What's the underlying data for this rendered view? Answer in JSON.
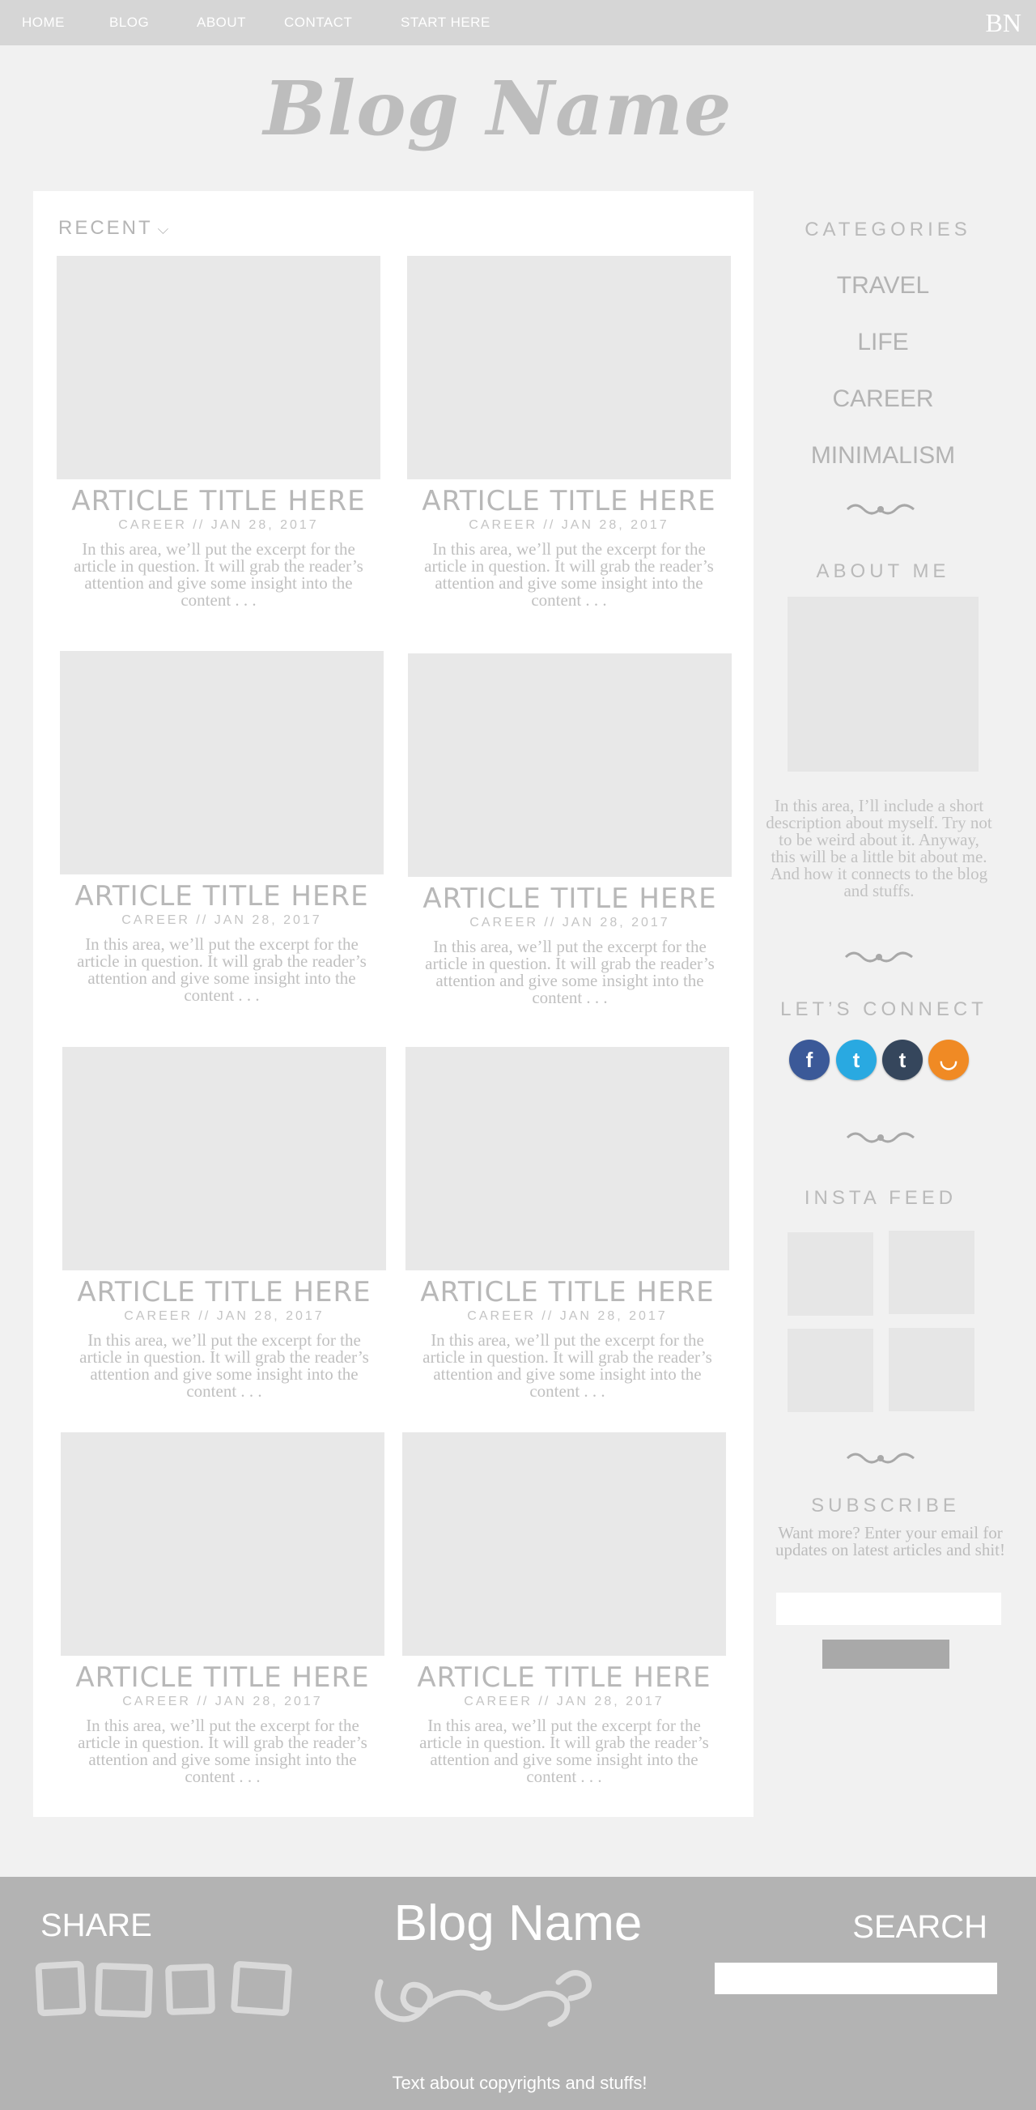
{
  "nav": {
    "items": [
      "HOME",
      "BLOG",
      "ABOUT",
      "CONTACT",
      "START HERE"
    ],
    "monogram": "BN"
  },
  "header": {
    "blog_name": "Blog Name"
  },
  "recent": {
    "label": "RECENT",
    "icon": "chevron-down-icon"
  },
  "posts": [
    {
      "title": "ARTICLE TITLE HERE",
      "meta": "CAREER // JAN 28, 2017",
      "excerpt": "In this area, we’ll put the excerpt for the article in question. It will grab the reader’s attention and give some insight into the content . . ."
    },
    {
      "title": "ARTICLE TITLE HERE",
      "meta": "CAREER // JAN 28, 2017",
      "excerpt": "In this area, we’ll put the excerpt for the article in question. It will grab the reader’s attention and give some insight into the content . . ."
    },
    {
      "title": "ARTICLE TITLE HERE",
      "meta": "CAREER // JAN 28, 2017",
      "excerpt": "In this area, we’ll put the excerpt for the article in question. It will grab the reader’s attention and give some insight into the content . . ."
    },
    {
      "title": "ARTICLE TITLE HERE",
      "meta": "CAREER // JAN 28, 2017",
      "excerpt": "In this area, we’ll put the excerpt for the article in question. It will grab the reader’s attention and give some insight into the content . . ."
    },
    {
      "title": "ARTICLE TITLE HERE",
      "meta": "CAREER // JAN 28, 2017",
      "excerpt": "In this area, we’ll put the excerpt for the article in question. It will grab the reader’s attention and give some insight into the content . . ."
    },
    {
      "title": "ARTICLE TITLE HERE",
      "meta": "CAREER // JAN 28, 2017",
      "excerpt": "In this area, we’ll put the excerpt for the article in question. It will grab the reader’s attention and give some insight into the content . . ."
    },
    {
      "title": "ARTICLE TITLE HERE",
      "meta": "CAREER // JAN 28, 2017",
      "excerpt": "In this area, we’ll put the excerpt for the article in question. It will grab the reader’s attention and give some insight into the content . . ."
    },
    {
      "title": "ARTICLE TITLE HERE",
      "meta": "CAREER // JAN 28, 2017",
      "excerpt": "In this area, we’ll put the excerpt for the article in question. It will grab the reader’s attention and give some insight into the content . . ."
    }
  ],
  "sidebar": {
    "categories_heading": "CATEGORIES",
    "categories": [
      "TRAVEL",
      "LIFE",
      "CAREER",
      "MINIMALISM"
    ],
    "about_heading": "ABOUT ME",
    "about_text": "In this area, I’ll include a short description about myself. Try not to be weird about it. Anyway, this will be a little bit about me. And how it connects to the blog and stuffs.",
    "connect_heading": "LET’S CONNECT",
    "social": [
      {
        "name": "facebook-icon",
        "glyph": "f",
        "color": "#3b5998"
      },
      {
        "name": "twitter-icon",
        "glyph": "t",
        "color": "#29a9e1"
      },
      {
        "name": "tumblr-icon",
        "glyph": "t",
        "color": "#35465c"
      },
      {
        "name": "rss-icon",
        "glyph": "◡",
        "color": "#f08a24"
      }
    ],
    "insta_heading": "INSTA FEED",
    "subscribe_heading": "SUBSCRIBE",
    "subscribe_text": "Want more? Enter your email for updates on latest articles and shit!"
  },
  "footer": {
    "share_label": "SHARE",
    "blog_name": "Blog Name",
    "search_label": "SEARCH",
    "copyright": "Text about copyrights and stuffs!"
  },
  "colors": {
    "topbar": "#d6d6d6",
    "page_bg": "#f1f1f1",
    "footer_bg": "#b3b3b3",
    "placeholder": "#e8e8e8"
  }
}
